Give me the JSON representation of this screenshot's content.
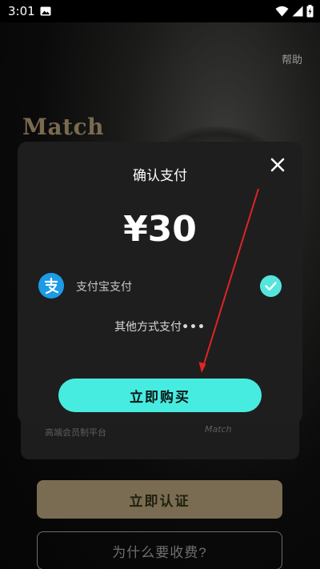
{
  "status_bar": {
    "time": "3:01"
  },
  "background": {
    "help_label": "帮助",
    "logo_text": "Match",
    "card_left_text": "高端会员制平台",
    "card_right_text": "Match",
    "verify_button_label": "立即认证",
    "why_button_label": "为什么要收费?"
  },
  "dialog": {
    "title": "确认支付",
    "price": "¥30",
    "payment_method": {
      "icon": "alipay-icon",
      "label": "支付宝支付",
      "selected": true
    },
    "other_methods_label": "其他方式支付",
    "other_methods_dots": "•••",
    "buy_button_label": "立即购买"
  },
  "colors": {
    "accent_cyan": "#47ece1",
    "check_cyan": "#55e5dd",
    "alipay_blue": "#1c9be6",
    "verify_gold": "#7a6c52",
    "annotation_red": "#e02424"
  }
}
